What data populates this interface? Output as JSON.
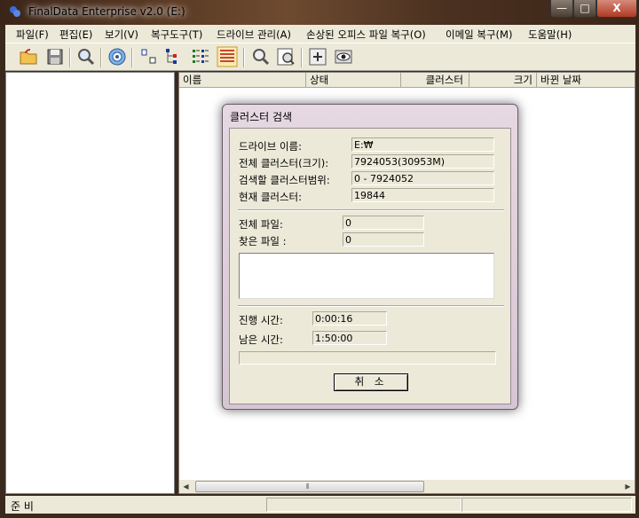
{
  "window": {
    "title": "FinalData Enterprise v2.0 (E:)",
    "minimize": "—",
    "maximize": "□",
    "close": "X"
  },
  "menu": [
    "파일(F)",
    "편집(E)",
    "보기(V)",
    "복구도구(T)",
    "드라이브 관리(A)",
    "손상된 오피스 파일 복구(O)",
    "이메일 복구(M)",
    "도움말(H)"
  ],
  "toolbar": {
    "icons": [
      "open-folder-icon",
      "save-icon",
      "search-icon",
      "target-icon",
      "small-icons-view-icon",
      "tree-view-icon",
      "list-view-icon",
      "details-view-icon",
      "zoom-icon",
      "preview-icon",
      "new-window-icon",
      "eye-icon"
    ]
  },
  "list": {
    "columns": [
      "이름",
      "상태",
      "클러스터",
      "크기",
      "바뀐 날짜"
    ]
  },
  "status": {
    "text": "준 비"
  },
  "dialog": {
    "title": "클러스터 검색",
    "drive_label": "드라이브 이름:",
    "drive_value": "E:₩",
    "total_clusters_label": "전체 클러스터(크기):",
    "total_clusters_value": "7924053(30953M)",
    "range_label": "검색할 클러스터범위:",
    "range_value": "0 - 7924052",
    "current_label": "현재 클러스터:",
    "current_value": "19844",
    "total_files_label": "전체 파일:",
    "total_files_value": "0",
    "found_files_label": "찾은 파일 :",
    "found_files_value": "0",
    "elapsed_label": "진행 시간:",
    "elapsed_value": "0:00:16",
    "remaining_label": "남은 시간:",
    "remaining_value": "1:50:00",
    "progress": 0.0,
    "cancel_label": "취 소"
  },
  "scroll": {
    "grip": "⦀"
  }
}
